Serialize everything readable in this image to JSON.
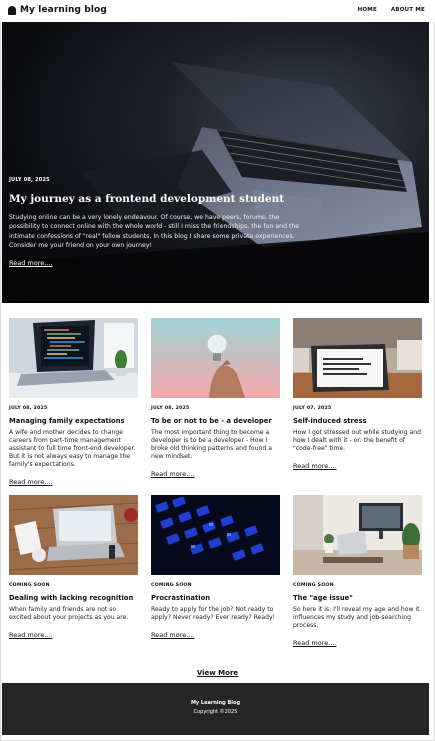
{
  "header": {
    "title": "My learning blog",
    "nav": [
      "HOME",
      "ABOUT ME"
    ]
  },
  "hero": {
    "date": "JULY 08, 2025",
    "title": "My journey as a frontend development student",
    "text": "Studying online can be a very lonely endeavour. Of course, we have peers, forums, the possibility to connect online with the whole world - still I miss the friendships, the fun and the intimate confessions of \"real\" fellow students. In this blog I share some private experiences. Consider me your friend on your own journey!",
    "read_more": "Read more...."
  },
  "cards": [
    {
      "date": "JULY 08, 2025",
      "title": "Managing family expectations",
      "text": "A wife and mother decides to change careers from part-time management assistant to full time front-end developer. But it is not always easy to manage the family's expectations.",
      "read_more": "Read more...."
    },
    {
      "date": "JULY 08, 2025",
      "title": "To be or not to be - a developer",
      "text": "The most important thing to become a developer is to be a developer - How I broke old thinking patterns and found a new mindset.",
      "read_more": "Read more...."
    },
    {
      "date": "JULY 07, 2025",
      "title": "Self-induced stress",
      "text": "How I got stressed out while studying and how I dealt with it - or: the benefit of \"code-free\" time.",
      "read_more": "Read more...."
    },
    {
      "date": "COMING SOON",
      "title": "Dealing with lacking recognition",
      "text": "When family and friends are not so excited about your projects as you are.",
      "read_more": "Read more...."
    },
    {
      "date": "COMING SOON",
      "title": "Procrastination",
      "text": "Ready to apply for the job? Not ready to apply? Never ready? Ever ready? Ready!",
      "read_more": "Read more...."
    },
    {
      "date": "COMING SOON",
      "title": "The \"age issue\"",
      "text": "So here it is: I'll reveal my age and how it influences my study and job-searching process.",
      "read_more": "Read more...."
    }
  ],
  "view_more": "View More",
  "footer": {
    "title": "My Learning Blog",
    "copyright": "Copyright ©2025"
  },
  "icons": {
    "logo": "blog-logo-icon"
  },
  "colors": {
    "footer_bg": "#252525",
    "hero_bg": "#0c0d11"
  }
}
